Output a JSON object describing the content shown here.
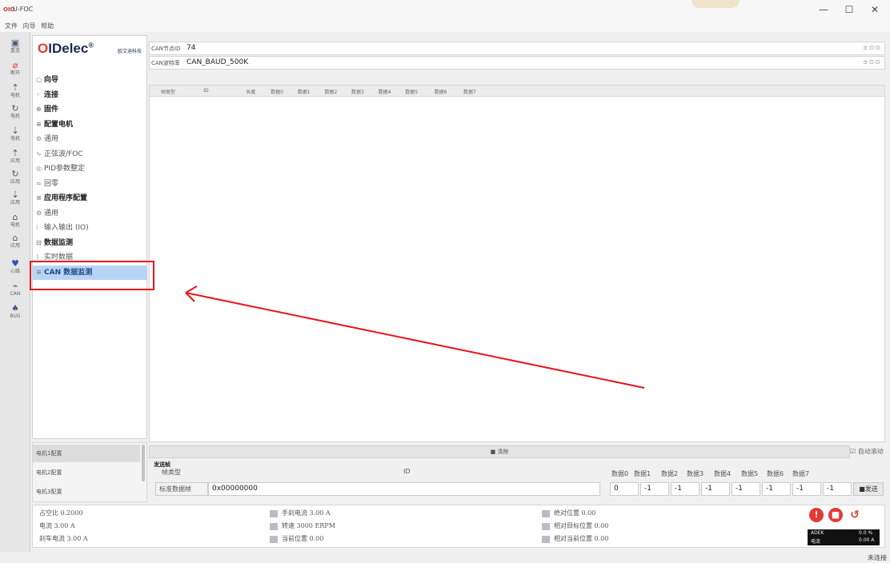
{
  "window": {
    "logo": "OIO",
    "title": "U-FOC",
    "controls": [
      "—",
      "☐",
      "✕"
    ]
  },
  "menu": [
    "文件",
    "向导",
    "帮助"
  ],
  "toolbar": [
    {
      "icon": "▣",
      "label": "重连"
    },
    {
      "icon": "⌀",
      "label": "断开"
    },
    {
      "icon": "⇡",
      "label": "电机"
    },
    {
      "icon": "↻",
      "label": "电机"
    },
    {
      "icon": "⇣",
      "label": "电机"
    },
    {
      "icon": "⇡",
      "label": "应用"
    },
    {
      "icon": "↻",
      "label": "应用"
    },
    {
      "icon": "⇣",
      "label": "应用"
    },
    {
      "icon": "⌂",
      "label": "电机"
    },
    {
      "icon": "⌂",
      "label": "应用"
    },
    {
      "icon": "♥",
      "label": "心跳"
    },
    {
      "icon": "⌁",
      "label": "CAN"
    },
    {
      "icon": "♠",
      "label": "BUG"
    }
  ],
  "brand": {
    "name_o": "O",
    "name": "IDelec",
    "reg": "®",
    "subtitle": "欧艾迪科技"
  },
  "nav": [
    {
      "label": "向导",
      "icon": "○",
      "bold": true
    },
    {
      "label": "连接",
      "icon": "◦",
      "bold": true
    },
    {
      "label": "固件",
      "icon": "⊕",
      "bold": true
    },
    {
      "label": "配置电机",
      "icon": "≡",
      "bold": true
    },
    {
      "label": "通用",
      "icon": "⚙",
      "bold": false
    },
    {
      "label": "正弦波/FOC",
      "icon": "∿",
      "bold": false
    },
    {
      "label": "PID参数整定",
      "icon": "◎",
      "bold": false
    },
    {
      "label": "回零",
      "icon": "≈",
      "bold": false
    },
    {
      "label": "应用程序配置",
      "icon": "≡",
      "bold": true
    },
    {
      "label": "通用",
      "icon": "⚙",
      "bold": false
    },
    {
      "label": "输入输出 (IO)",
      "icon": "⁞",
      "bold": false
    },
    {
      "label": "数据监测",
      "icon": "⊟",
      "bold": true
    },
    {
      "label": "实时数据",
      "icon": "⌇",
      "bold": false
    },
    {
      "label": "CAN 数据监测",
      "icon": "≡",
      "bold": true,
      "selected": true
    }
  ],
  "motor_configs": [
    "电机1配置",
    "电机2配置",
    "电机3配置"
  ],
  "params": {
    "node_label": "CAN节点ID",
    "node_value": "74",
    "baud_label": "CAN波特率",
    "baud_value": "CAN_BAUD_500K",
    "ctrl": "±⊙⊙"
  },
  "table_headers": [
    "帧类型",
    "ID",
    "长度",
    "数据0",
    "数据1",
    "数据2",
    "数据3",
    "数据4",
    "数据5",
    "数据6",
    "数据7"
  ],
  "clear_label": "■ 清除",
  "autoscroll_label": "☑ 自动滚动",
  "send": {
    "title": "发送帧",
    "frame_type_label": "帧类型",
    "id_label": "ID",
    "data_labels": [
      "数据0",
      "数据1",
      "数据2",
      "数据3",
      "数据4",
      "数据5",
      "数据6",
      "数据7"
    ],
    "frame_type_value": "标准数据帧",
    "frame_id_value": "0x00000000",
    "bytes": [
      "0",
      "-1",
      "-1",
      "-1",
      "-1",
      "-1",
      "-1",
      "-1"
    ],
    "send_label": "■发送"
  },
  "status": {
    "col1": [
      "占空比 0.2000",
      "电流 3.00 A",
      "刹车电流 3.00 A"
    ],
    "col2": [
      "手刹电流 3.00 A",
      "转速 3000 ERPM",
      "当前位置 0.00"
    ],
    "col3": [
      "绝对位置 0.00",
      "相对目标位置 0.00",
      "相对当前位置 0.00"
    ],
    "buttons": [
      "!",
      "■",
      "↺"
    ],
    "gauge": [
      "ADEK",
      "0.0 %",
      "电流",
      "0.00 A"
    ]
  },
  "connection_status": "未连接"
}
